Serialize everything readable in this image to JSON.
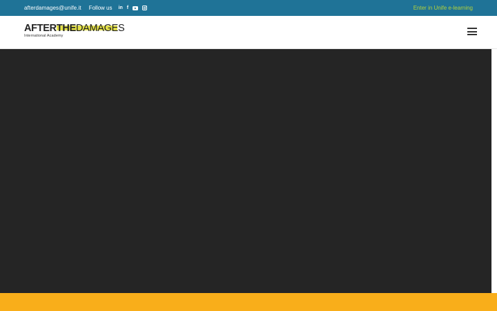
{
  "topbar": {
    "email": "afterdamages@unife.it",
    "follow_label": "Follow us",
    "social_icons": [
      "linkedin-icon",
      "facebook-icon",
      "youtube-icon",
      "instagram-icon"
    ],
    "elearning_link": "Enter in Unife e-learning",
    "background": "#1f7397",
    "link_color": "#b3d23a"
  },
  "header": {
    "logo": {
      "word1": "AFTER",
      "word2": "THE",
      "word3": "DAMAGES",
      "tagline": "International Academy",
      "highlight_color": "#e4e14a"
    },
    "menu_icon": "hamburger-menu-icon"
  },
  "hero": {
    "background": "#252525"
  },
  "footer_band": {
    "background": "#f9ae1a"
  }
}
